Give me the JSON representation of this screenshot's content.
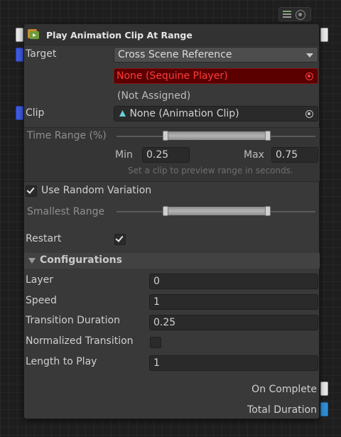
{
  "node": {
    "title": "Play Animation Clip At Range",
    "target_label": "Target",
    "target_dropdown": "Cross Scene Reference",
    "target_object": "None (Sequine Player)",
    "target_status": "(Not Assigned)",
    "clip_label": "Clip",
    "clip_value": "None (Animation Clip)",
    "time_range_label": "Time Range (%)",
    "min_label": "Min",
    "min_value": "0.25",
    "max_label": "Max",
    "max_value": "0.75",
    "range_hint": "Set a clip to preview range in seconds.",
    "random_variation_label": "Use Random Variation",
    "random_variation_checked": true,
    "smallest_range_label": "Smallest Range",
    "restart_label": "Restart",
    "restart_checked": true,
    "configurations_label": "Configurations",
    "layer_label": "Layer",
    "layer_value": "0",
    "speed_label": "Speed",
    "speed_value": "1",
    "transition_duration_label": "Transition Duration",
    "transition_duration_value": "0.25",
    "normalized_transition_label": "Normalized Transition",
    "normalized_transition_checked": false,
    "length_to_play_label": "Length to Play",
    "length_to_play_value": "1",
    "on_complete_label": "On Complete",
    "total_duration_label": "Total Duration"
  },
  "icons": {
    "toolbar_a": "node-settings-icon",
    "toolbar_b": "target-icon",
    "header": "animation-node-icon",
    "object_picker": "object-picker-icon",
    "clip": "animation-clip-icon"
  },
  "colors": {
    "port_flow": "#e8e8e8",
    "port_object": "#3f5be0",
    "port_float": "#2e8fd6",
    "error_text": "#ff3b3b",
    "error_bg": "#5a0000"
  }
}
